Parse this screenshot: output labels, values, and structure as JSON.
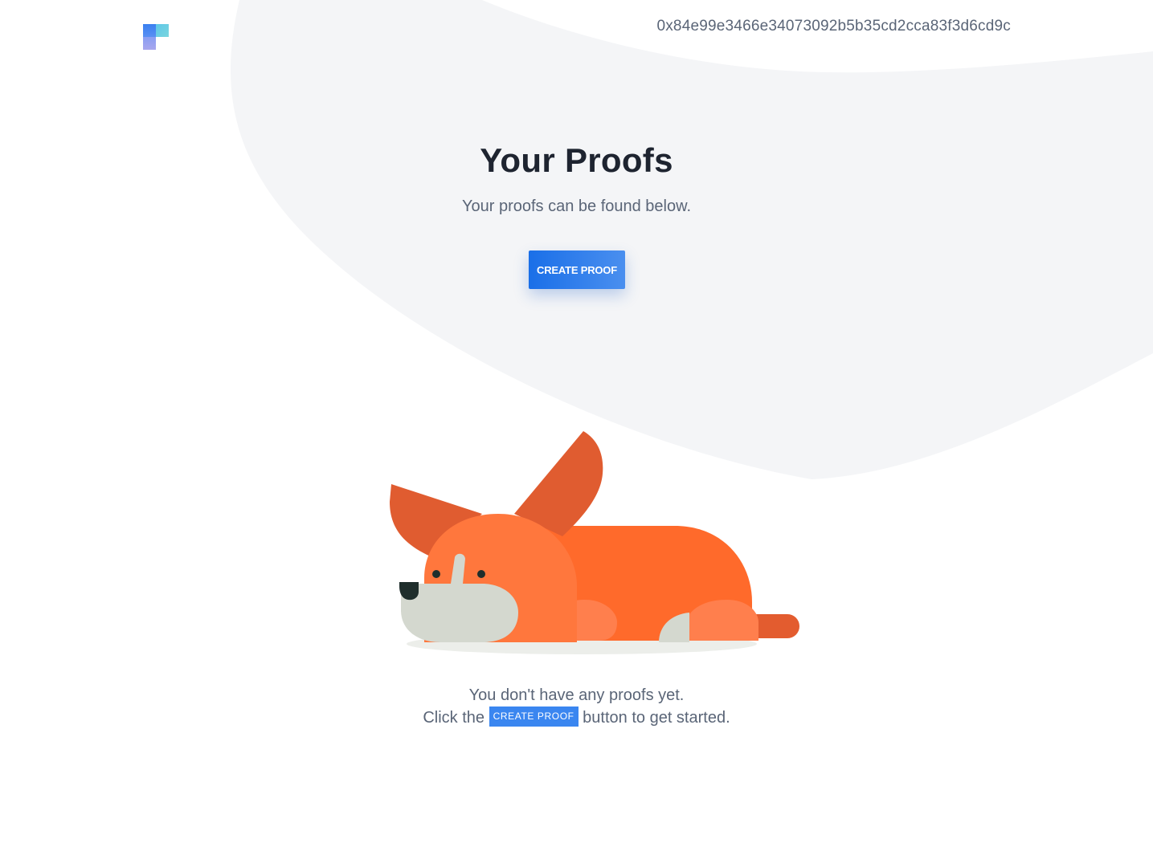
{
  "header": {
    "logo_icon": "stacked-squares-logo-icon",
    "account_address": "0x84e99e3466e34073092b5b35cd2cca83f3d6cd9c"
  },
  "hero": {
    "title": "Your Proofs",
    "subtitle": "Your proofs can be found below.",
    "create_button_label": "CREATE PROOF"
  },
  "empty_state": {
    "illustration": "sleeping-corgi-illustration",
    "line1": "You don't have any proofs yet.",
    "line2_prefix": "Click the",
    "line2_badge": "CREATE PROOF",
    "line2_suffix": "button to get started."
  },
  "colors": {
    "accent": "#1a6fe8",
    "background_blob": "#f4f5f7",
    "text_primary": "#1e2430",
    "text_secondary": "#5a6577",
    "corgi_orange": "#ff6a2b"
  }
}
